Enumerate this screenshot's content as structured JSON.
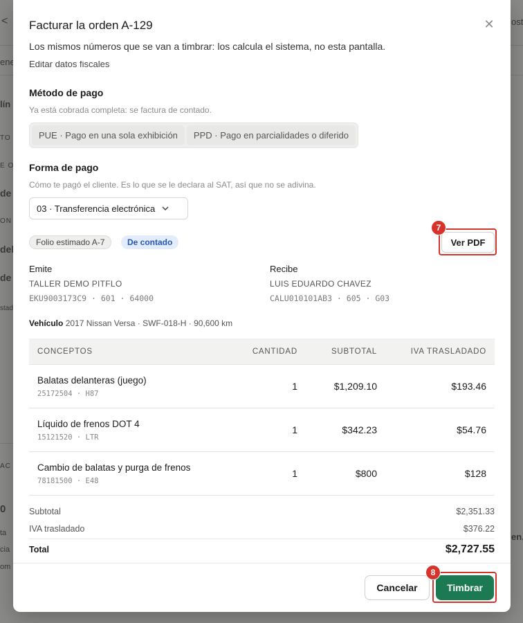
{
  "background": {
    "fragments": [
      "<",
      "ost",
      "ene",
      "lín",
      "TO",
      "E O",
      "de",
      "ON",
      "dela",
      "de",
      "stad",
      "AC",
      "0",
      "ta",
      "cia",
      "om",
      "en."
    ]
  },
  "modal": {
    "title": "Facturar la orden A-129",
    "subtitle": "Los mismos números que se van a timbrar: los calcula el sistema, no esta pantalla.",
    "edit_link": "Editar datos fiscales",
    "payment_method": {
      "title": "Método de pago",
      "help": "Ya está cobrada completa: se factura de contado.",
      "options": [
        "PUE · Pago en una sola exhibición",
        "PPD · Pago en parcialidades o diferido"
      ]
    },
    "payment_form": {
      "title": "Forma de pago",
      "help": "Cómo te pagó el cliente. Es lo que se le declara al SAT, así que no se adivina.",
      "selected": "03 · Transferencia electrónica"
    },
    "badges": {
      "folio": "Folio estimado A-7",
      "status": "De contado"
    },
    "pdf_button": "Ver PDF",
    "annotations": {
      "pdf": "7",
      "stamp": "8"
    },
    "issuer": {
      "label": "Emite",
      "name": "TALLER DEMO PITFLO",
      "ids": "EKU9003173C9 · 601 · 64000"
    },
    "receiver": {
      "label": "Recibe",
      "name": "LUIS EDUARDO CHAVEZ",
      "ids": "CALU010101AB3 · 605 · G03"
    },
    "vehicle": {
      "label": "Vehículo",
      "value": "2017 Nissan Versa · SWF-018-H · 90,600 km"
    },
    "table": {
      "headers": [
        "CONCEPTOS",
        "CANTIDAD",
        "SUBTOTAL",
        "IVA TRASLADADO"
      ],
      "rows": [
        {
          "name": "Balatas delanteras (juego)",
          "code": "25172504 · H87",
          "qty": "1",
          "subtotal": "$1,209.10",
          "iva": "$193.46"
        },
        {
          "name": "Líquido de frenos DOT 4",
          "code": "15121520 · LTR",
          "qty": "1",
          "subtotal": "$342.23",
          "iva": "$54.76"
        },
        {
          "name": "Cambio de balatas y purga de frenos",
          "code": "78181500 · E48",
          "qty": "1",
          "subtotal": "$800",
          "iva": "$128"
        }
      ]
    },
    "totals": {
      "subtotal_label": "Subtotal",
      "subtotal": "$2,351.33",
      "iva_label": "IVA trasladado",
      "iva": "$376.22",
      "total_label": "Total",
      "total": "$2,727.55"
    },
    "footer": {
      "cancel": "Cancelar",
      "submit": "Timbrar"
    }
  },
  "colors": {
    "primary": "#1c7a52",
    "highlight": "#d0342c",
    "badge_blue_bg": "#e3ecfa",
    "badge_blue_text": "#2657b8"
  },
  "icons": {
    "close": "close-icon",
    "chevron": "chevron-down-icon"
  }
}
